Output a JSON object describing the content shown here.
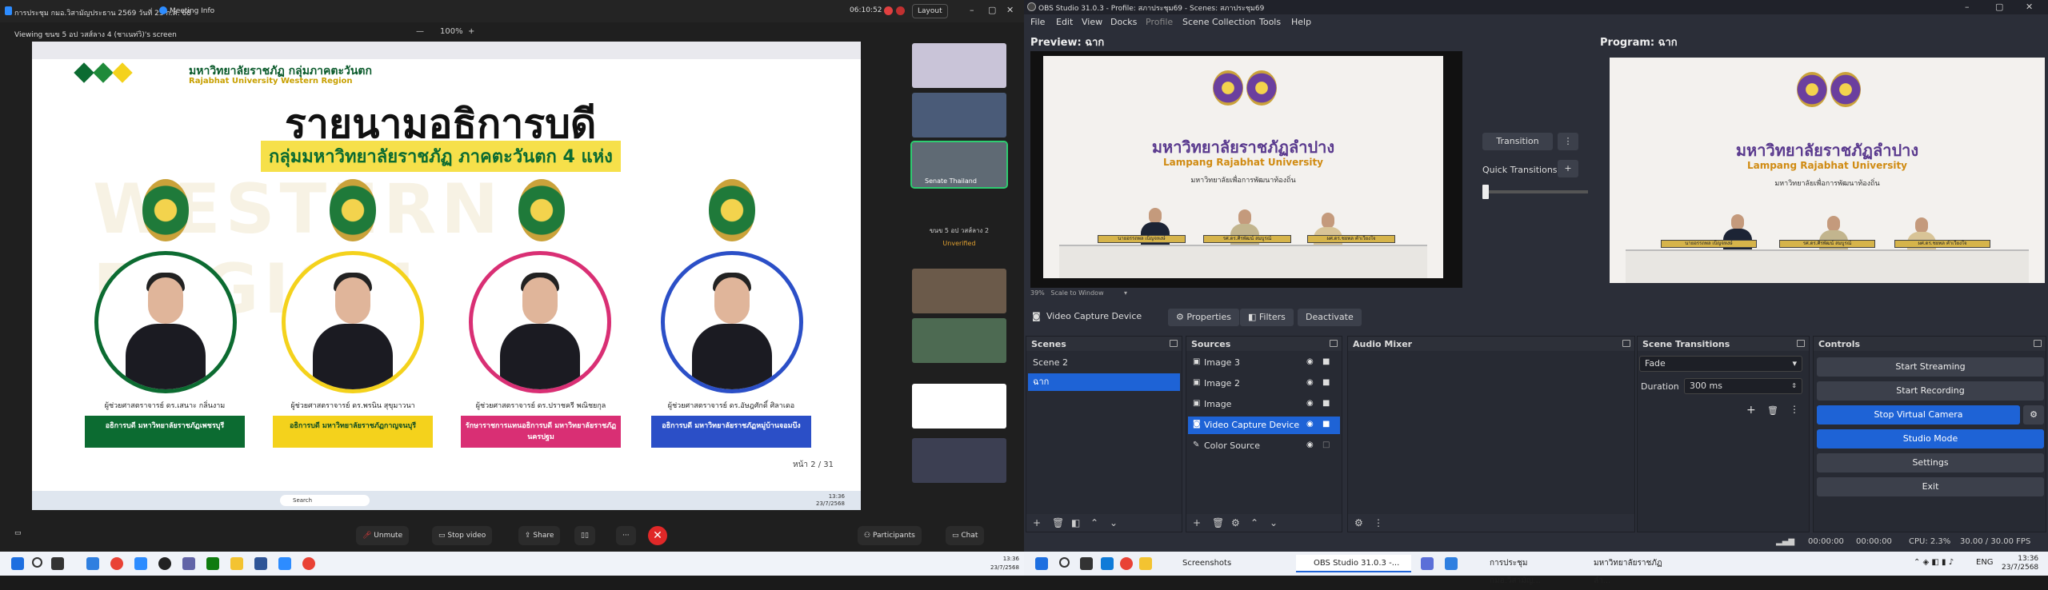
{
  "zoom": {
    "window_title": "การประชุม กมอ.วิสามัญประธาน 2569 วันที่ 23 ก.ค. 68",
    "meeting_info": "Meeting Info",
    "clock": "06:10:52",
    "layout_label": "Layout",
    "viewing": "Viewing ขนข 5 อป วสส์ลาง 4 (ชาเนท่วิ)'s screen",
    "zoom_level": "100%",
    "slide": {
      "header_th": "มหาวิทยาลัยราชภัฏ กลุ่มภาคตะวันตก",
      "header_en": "Rajabhat University Western Region",
      "title": "รายนามอธิการบดี",
      "subtitle": "กลุ่มมหาวิทยาลัยราชภัฏ ภาคตะวันตก 4 แห่ง",
      "watermark": "WESTERN REGION",
      "people": [
        {
          "name": "ผู้ช่วยศาสตราจารย์ ดร.เสนาะ กลิ่นงาม",
          "title": "อธิการบดี มหาวิทยาลัยราชภัฏเพชรบุรี",
          "color": "#0c6b31"
        },
        {
          "name": "ผู้ช่วยศาสตราจารย์ ดร.พรนิน สุขุมาวนา",
          "title": "อธิการบดี มหาวิทยาลัยราชภัฏกาญจนบุรี",
          "color": "#f4d21c"
        },
        {
          "name": "ผู้ช่วยศาสตราจารย์ ดร.ปราชครี พณิชยกุล",
          "title": "รักษาราชการแทนอธิการบดี มหาวิทยาลัยราชภัฏนครปฐม",
          "color": "#d92f74"
        },
        {
          "name": "ผู้ช่วยศาสตราจารย์ ดร.อัษฎศักดิ์ ศิลาเดอ",
          "title": "อธิการบดี มหาวิทยาลัยราชภัฏหมู่บ้านจอมบึง",
          "color": "#2b4fc7"
        }
      ],
      "page": "หน้า 2 / 31",
      "search": "Search",
      "time": "13:36",
      "date": "23/7/2568"
    },
    "thumbs": {
      "senate_caption": "Senate Thailand",
      "tile_name": "ขนข 5 อป วสส์ลาง 2",
      "unverified": "Unverified"
    },
    "controls": {
      "unmute": "Unmute",
      "stop_video": "Stop video",
      "share": "Share",
      "participants": "Participants",
      "chat": "Chat"
    }
  },
  "obs": {
    "title": "OBS Studio 31.0.3 - Profile: สภาประชุม69 - Scenes: สภาประชุม69",
    "menu": [
      "File",
      "Edit",
      "View",
      "Docks",
      "Profile",
      "Scene Collection",
      "Tools",
      "Help"
    ],
    "preview_label": "Preview: ฉาก",
    "program_label": "Program: ฉาก",
    "frame": {
      "th": "มหาวิทยาลัยราชภัฏลำปาง",
      "en": "Lampang Rajabhat University",
      "tag": "มหาวิทยาลัยเพื่อการพัฒนาท้องถิ่น",
      "plates": [
        "นายอรรถพล เบ็ญจหงษ์",
        "รศ.ดร.ศิรพัฒน์ สมบูรณ์",
        "ผศ.ดร.ชยพล คำเวียงใจ"
      ]
    },
    "transition_btn": "Transition",
    "quick_transitions": "Quick Transitions",
    "zoom_readout": "39%",
    "scale_mode": "Scale to Window",
    "source_name": "Video Capture Device",
    "properties": "Properties",
    "filters": "Filters",
    "deactivate": "Deactivate",
    "docks": {
      "scenes": "Scenes",
      "sources": "Sources",
      "audio_mixer": "Audio Mixer",
      "scene_transitions": "Scene Transitions",
      "controls": "Controls"
    },
    "scenes": [
      "Scene 2",
      "ฉาก"
    ],
    "sources": [
      "Image 3",
      "Image 2",
      "Image",
      "Video Capture Device",
      "Color Source"
    ],
    "transition": {
      "type": "Fade",
      "duration_label": "Duration",
      "duration": "300 ms"
    },
    "control_buttons": {
      "stream": "Start Streaming",
      "record": "Start Recording",
      "vcam": "Stop Virtual Camera",
      "studio": "Studio Mode",
      "settings": "Settings",
      "exit": "Exit"
    },
    "status": {
      "t1": "00:00:00",
      "t2": "00:00:00",
      "cpu": "CPU: 2.3%",
      "fps": "30.00 / 30.00 FPS"
    }
  },
  "taskbar": {
    "left_time": "13:36",
    "left_date": "23/7/2568",
    "apps": [
      {
        "label": "Screenshots"
      },
      {
        "label": "OBS Studio 31.0.3 -..."
      },
      {
        "label": "การประชุม กมอ.วิสามัญ..."
      },
      {
        "label": "มหาวิทยาลัยราชภัฏลำ..."
      }
    ],
    "lang": "ENG",
    "time": "13:36",
    "date": "23/7/2568"
  }
}
